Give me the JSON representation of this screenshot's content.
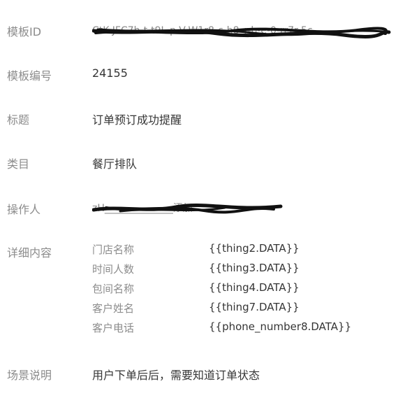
{
  "fields": {
    "template_id": {
      "label": "模板ID",
      "value": "(redacted)"
    },
    "template_no": {
      "label": "模板编号",
      "value": "24155"
    },
    "title": {
      "label": "标题",
      "value": "订单预订成功提醒"
    },
    "category": {
      "label": "类目",
      "value": "餐厅排队"
    },
    "operator": {
      "label": "操作人",
      "value": "(redacted)"
    },
    "details": {
      "label": "详细内容",
      "items": [
        {
          "key": "门店名称",
          "value": "{{thing2.DATA}}"
        },
        {
          "key": "时间人数",
          "value": "{{thing3.DATA}}"
        },
        {
          "key": "包间名称",
          "value": "{{thing4.DATA}}"
        },
        {
          "key": "客户姓名",
          "value": "{{thing7.DATA}}"
        },
        {
          "key": "客户电话",
          "value": "{{phone_number8.DATA}}"
        }
      ]
    },
    "scenario": {
      "label": "场景说明",
      "value": "用户下单后后，需要知道订单状态"
    }
  },
  "colors": {
    "label": "#8c8c8c",
    "value": "#353535",
    "redaction": "#111111"
  }
}
